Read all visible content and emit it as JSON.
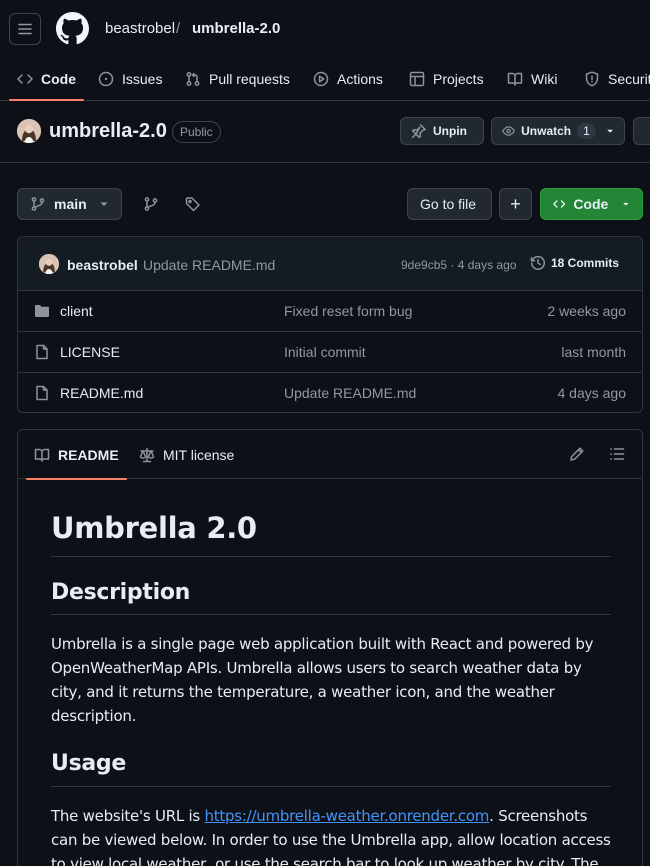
{
  "header": {
    "owner": "beastrobel",
    "separator": "/",
    "repo": "umbrella-2.0"
  },
  "nav": {
    "tabs": [
      {
        "label": "Code",
        "icon": "code-icon"
      },
      {
        "label": "Issues",
        "icon": "issue-icon"
      },
      {
        "label": "Pull requests",
        "icon": "pull-request-icon"
      },
      {
        "label": "Actions",
        "icon": "play-icon"
      },
      {
        "label": "Projects",
        "icon": "table-icon"
      },
      {
        "label": "Wiki",
        "icon": "book-icon"
      },
      {
        "label": "Securit",
        "icon": "shield-icon"
      }
    ]
  },
  "repo": {
    "name": "umbrella-2.0",
    "visibility": "Public",
    "unpin_label": "Unpin",
    "unwatch_label": "Unwatch",
    "watch_count": "1"
  },
  "toolbar": {
    "branch": "main",
    "goto_file": "Go to file",
    "add": "+",
    "code": "Code"
  },
  "commit": {
    "author": "beastrobel",
    "message": "Update README.md",
    "hash_date": "9de9cb5 · 4 days ago",
    "commits_label": "18 Commits"
  },
  "files": [
    {
      "name": "client",
      "type": "folder",
      "message": "Fixed reset form bug",
      "date": "2 weeks ago"
    },
    {
      "name": "LICENSE",
      "type": "file",
      "message": "Initial commit",
      "date": "last month"
    },
    {
      "name": "README.md",
      "type": "file",
      "message": "Update README.md",
      "date": "4 days ago"
    }
  ],
  "readme": {
    "tab_readme": "README",
    "tab_license": "MIT license",
    "title": "Umbrella 2.0",
    "h_description": "Description",
    "description": "Umbrella is a single page web application built with React and powered by OpenWeatherMap APIs. Umbrella allows users to search weather data by city, and it returns the temperature, a weather icon, and the weather description.",
    "h_usage": "Usage",
    "usage_before": "The website's URL is ",
    "usage_link": "https://umbrella-weather.onrender.com",
    "usage_after": ". Screenshots can be viewed below. In order to use the Umbrella app, allow location access to view local weather, or use the search bar to look up weather by city. The"
  },
  "colors": {
    "background": "#0d1117",
    "accent_tab": "#f78166",
    "code_button": "#238636",
    "link": "#4493f8"
  }
}
